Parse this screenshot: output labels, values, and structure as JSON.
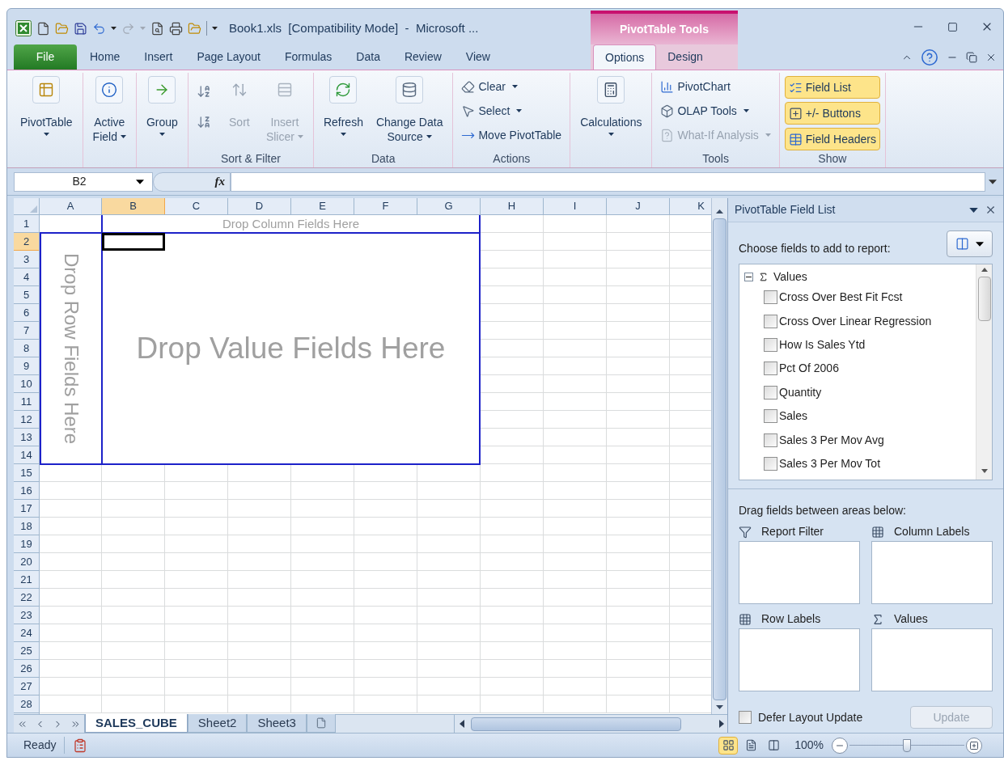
{
  "title_bar": {
    "title": "Book1.xls  [Compatibility Mode]  -  Microsoft ...",
    "context_group": "PivotTable Tools"
  },
  "ribbon_tabs": [
    {
      "label": "File",
      "kind": "file",
      "selected": false
    },
    {
      "label": "Home",
      "kind": "tab",
      "selected": false
    },
    {
      "label": "Insert",
      "kind": "tab",
      "selected": false
    },
    {
      "label": "Page Layout",
      "kind": "tab",
      "selected": false
    },
    {
      "label": "Formulas",
      "kind": "tab",
      "selected": false
    },
    {
      "label": "Data",
      "kind": "tab",
      "selected": false
    },
    {
      "label": "Review",
      "kind": "tab",
      "selected": false
    },
    {
      "label": "View",
      "kind": "tab",
      "selected": false
    },
    {
      "label": "Options",
      "kind": "context",
      "selected": true
    },
    {
      "label": "Design",
      "kind": "context",
      "selected": false
    }
  ],
  "ribbon_groups": [
    {
      "items": [
        {
          "kind": "large",
          "lines": [
            "PivotTable"
          ],
          "dropdown": true,
          "disabled": false
        }
      ]
    },
    {
      "items": [
        {
          "kind": "large",
          "lines": [
            "Active",
            "Field"
          ],
          "dropdown": true,
          "disabled": false
        }
      ]
    },
    {
      "items": [
        {
          "kind": "large",
          "lines": [
            "Group"
          ],
          "dropdown": true,
          "disabled": false
        }
      ]
    },
    {
      "label": "Sort & Filter",
      "items": [
        {
          "kind": "icon_button",
          "disabled": false
        },
        {
          "kind": "icon_button",
          "disabled": false
        },
        {
          "kind": "large",
          "lines": [
            "Sort"
          ],
          "dropdown": false,
          "disabled": true
        },
        {
          "kind": "large",
          "lines": [
            "Insert",
            "Slicer"
          ],
          "dropdown": true,
          "disabled": true
        }
      ]
    },
    {
      "label": "Data",
      "items": [
        {
          "kind": "large",
          "lines": [
            "Refresh"
          ],
          "dropdown": true,
          "disabled": false
        },
        {
          "kind": "large",
          "lines": [
            "Change Data",
            "Source"
          ],
          "dropdown": true,
          "disabled": false
        }
      ]
    },
    {
      "label": "Actions",
      "items": [
        {
          "kind": "small",
          "label": "Clear",
          "dropdown": true,
          "disabled": false
        },
        {
          "kind": "small",
          "label": "Select",
          "dropdown": true,
          "disabled": false
        },
        {
          "kind": "small",
          "label": "Move PivotTable",
          "dropdown": false,
          "disabled": false
        }
      ]
    },
    {
      "items": [
        {
          "kind": "large",
          "lines": [
            "Calculations"
          ],
          "dropdown": true,
          "disabled": false
        }
      ]
    },
    {
      "label": "Tools",
      "items": [
        {
          "kind": "small",
          "label": "PivotChart",
          "dropdown": false,
          "disabled": false
        },
        {
          "kind": "small",
          "label": "OLAP Tools",
          "dropdown": true,
          "disabled": false
        },
        {
          "kind": "small",
          "label": "What-If Analysis",
          "dropdown": true,
          "disabled": true
        }
      ]
    },
    {
      "label": "Show",
      "items": [
        {
          "kind": "toggle",
          "label": "Field List",
          "checked": true
        },
        {
          "kind": "toggle",
          "label": "+/- Buttons",
          "checked": true
        },
        {
          "kind": "toggle",
          "label": "Field Headers",
          "checked": true
        }
      ]
    }
  ],
  "formula_bar": {
    "name_box": "B2",
    "function_label": "fx"
  },
  "columns": [
    {
      "label": "A",
      "selected": false
    },
    {
      "label": "B",
      "selected": true
    },
    {
      "label": "C",
      "selected": false
    },
    {
      "label": "D",
      "selected": false
    },
    {
      "label": "E",
      "selected": false
    },
    {
      "label": "F",
      "selected": false
    },
    {
      "label": "G",
      "selected": false
    },
    {
      "label": "H",
      "selected": false
    },
    {
      "label": "I",
      "selected": false
    },
    {
      "label": "J",
      "selected": false
    },
    {
      "label": "K",
      "selected": false
    }
  ],
  "rows": [
    {
      "label": "1",
      "selected": false
    },
    {
      "label": "2",
      "selected": true
    },
    {
      "label": "3",
      "selected": false
    },
    {
      "label": "4",
      "selected": false
    },
    {
      "label": "5",
      "selected": false
    },
    {
      "label": "6",
      "selected": false
    },
    {
      "label": "7",
      "selected": false
    },
    {
      "label": "8",
      "selected": false
    },
    {
      "label": "9",
      "selected": false
    },
    {
      "label": "10",
      "selected": false
    },
    {
      "label": "11",
      "selected": false
    },
    {
      "label": "12",
      "selected": false
    },
    {
      "label": "13",
      "selected": false
    },
    {
      "label": "14",
      "selected": false
    },
    {
      "label": "15",
      "selected": false
    },
    {
      "label": "16",
      "selected": false
    },
    {
      "label": "17",
      "selected": false
    },
    {
      "label": "18",
      "selected": false
    },
    {
      "label": "19",
      "selected": false
    },
    {
      "label": "20",
      "selected": false
    },
    {
      "label": "21",
      "selected": false
    },
    {
      "label": "22",
      "selected": false
    },
    {
      "label": "23",
      "selected": false
    },
    {
      "label": "24",
      "selected": false
    },
    {
      "label": "25",
      "selected": false
    },
    {
      "label": "26",
      "selected": false
    },
    {
      "label": "27",
      "selected": false
    },
    {
      "label": "28",
      "selected": false
    }
  ],
  "pivot_placeholders": {
    "column_fields": "Drop Column Fields Here",
    "row_fields": "Drop Row Fields Here",
    "value_fields": "Drop Value Fields Here"
  },
  "sheet_tabs": [
    {
      "label": "SALES_CUBE",
      "selected": true
    },
    {
      "label": "Sheet2",
      "selected": false
    },
    {
      "label": "Sheet3",
      "selected": false
    }
  ],
  "field_list": {
    "title": "PivotTable Field List",
    "prompt": "Choose fields to add to report:",
    "tree": [
      {
        "label": "Values",
        "expanded": true,
        "children": [
          {
            "label": "Cross Over Best Fit Fcst",
            "checked": false
          },
          {
            "label": "Cross Over Linear Regression",
            "checked": false
          },
          {
            "label": "How Is Sales Ytd",
            "checked": false
          },
          {
            "label": "Pct Of 2006",
            "checked": false
          },
          {
            "label": "Quantity",
            "checked": false
          },
          {
            "label": "Sales",
            "checked": false
          },
          {
            "label": "Sales 3 Per Mov Avg",
            "checked": false
          },
          {
            "label": "Sales 3 Per Mov Tot",
            "checked": false
          }
        ]
      }
    ],
    "areas_prompt": "Drag fields between areas below:",
    "areas": [
      {
        "label": "Report Filter",
        "kind": "filter"
      },
      {
        "label": "Column Labels",
        "kind": "columns"
      },
      {
        "label": "Row Labels",
        "kind": "rows"
      },
      {
        "label": "Values",
        "kind": "values"
      }
    ],
    "defer_update": {
      "label": "Defer Layout Update",
      "checked": false
    },
    "update_button": {
      "label": "Update",
      "disabled": true
    }
  },
  "status_bar": {
    "status": "Ready",
    "views": [
      {
        "kind": "normal",
        "selected": true
      },
      {
        "kind": "page_layout",
        "selected": false
      },
      {
        "kind": "page_break",
        "selected": false
      }
    ],
    "zoom": "100%",
    "zoom_slider": {
      "level": 0.5
    }
  }
}
